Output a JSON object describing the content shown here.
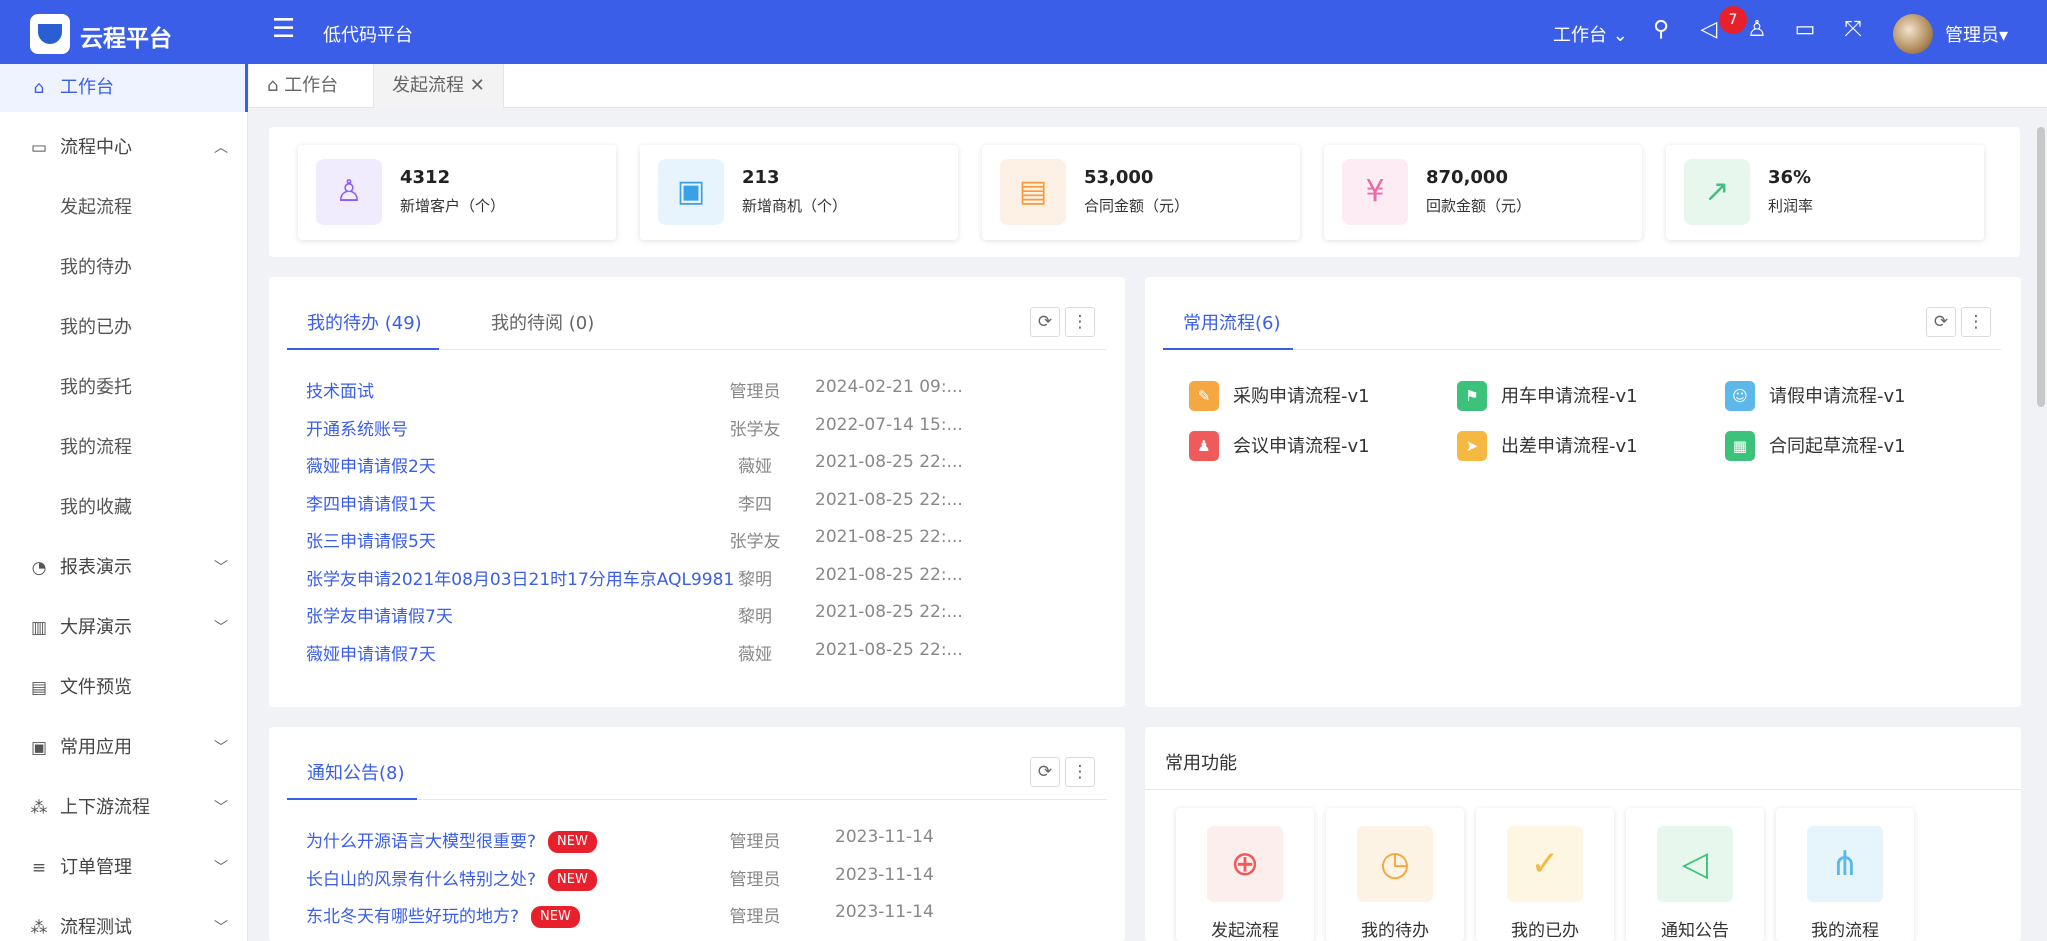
{
  "topbar": {
    "brand": "云程平台",
    "platform_title": "低代码平台",
    "workspace_label": "工作台",
    "notification_count": "7",
    "user_name": "管理员"
  },
  "sidebar": {
    "items": [
      {
        "label": "工作台",
        "icon": "home-icon"
      },
      {
        "label": "流程中心",
        "icon": "monitor-icon"
      },
      {
        "label": "发起流程"
      },
      {
        "label": "我的待办"
      },
      {
        "label": "我的已办"
      },
      {
        "label": "我的委托"
      },
      {
        "label": "我的流程"
      },
      {
        "label": "我的收藏"
      },
      {
        "label": "报表演示",
        "icon": "pie-chart-icon"
      },
      {
        "label": "大屏演示",
        "icon": "bar-chart-icon"
      },
      {
        "label": "文件预览",
        "icon": "file-search-icon"
      },
      {
        "label": "常用应用",
        "icon": "briefcase-icon"
      },
      {
        "label": "上下游流程",
        "icon": "flow-tree-icon"
      },
      {
        "label": "订单管理",
        "icon": "order-icon"
      },
      {
        "label": "流程测试",
        "icon": "flow-test-icon"
      }
    ]
  },
  "tabs": [
    {
      "label": "工作台"
    },
    {
      "label": "发起流程"
    }
  ],
  "stats": [
    {
      "value": "4312",
      "label": "新增客户（个）",
      "icon": "user-icon",
      "color": "#8b5cf6",
      "bg": "#f1ecfd"
    },
    {
      "value": "213",
      "label": "新增商机（个）",
      "icon": "archive-icon",
      "color": "#3aa0e8",
      "bg": "#e8f4fd"
    },
    {
      "value": "53,000",
      "label": "合同金额（元）",
      "icon": "document-icon",
      "color": "#f79a3a",
      "bg": "#fdf1e5"
    },
    {
      "value": "870,000",
      "label": "回款金额（元）",
      "icon": "money-bag-icon",
      "color": "#ea6aa5",
      "bg": "#fdecf3"
    },
    {
      "value": "36%",
      "label": "利润率",
      "icon": "trend-chart-icon",
      "color": "#3cc27a",
      "bg": "#e8f7ee"
    }
  ],
  "todo_panel": {
    "tab_active": "我的待办 (49)",
    "tab_other": "我的待阅 (0)",
    "rows": [
      {
        "title": "技术面试",
        "person": "管理员",
        "date": "2024-02-21 09:..."
      },
      {
        "title": "开通系统账号",
        "person": "张学友",
        "date": "2022-07-14 15:..."
      },
      {
        "title": "薇娅申请请假2天",
        "person": "薇娅",
        "date": "2021-08-25 22:..."
      },
      {
        "title": "李四申请请假1天",
        "person": "李四",
        "date": "2021-08-25 22:..."
      },
      {
        "title": "张三申请请假5天",
        "person": "张学友",
        "date": "2021-08-25 22:..."
      },
      {
        "title": "张学友申请2021年08月03日21时17分用车京AQL9981",
        "person": "黎明",
        "date": "2021-08-25 22:..."
      },
      {
        "title": "张学友申请请假7天",
        "person": "黎明",
        "date": "2021-08-25 22:..."
      },
      {
        "title": "薇娅申请请假7天",
        "person": "薇娅",
        "date": "2021-08-25 22:..."
      }
    ]
  },
  "process_panel": {
    "tab": "常用流程(6)",
    "items": [
      {
        "label": "采购申请流程-v1",
        "icon": "purchase-icon",
        "color": "#f5a742"
      },
      {
        "label": "用车申请流程-v1",
        "icon": "flag-icon",
        "color": "#3cc27a"
      },
      {
        "label": "请假申请流程-v1",
        "icon": "people-icon",
        "color": "#5cb8e8"
      },
      {
        "label": "会议申请流程-v1",
        "icon": "meeting-icon",
        "color": "#ef5a5a"
      },
      {
        "label": "出差申请流程-v1",
        "icon": "send-icon",
        "color": "#f5b942"
      },
      {
        "label": "合同起草流程-v1",
        "icon": "contract-icon",
        "color": "#3cc27a"
      }
    ]
  },
  "notice_panel": {
    "tab": "通知公告(8)",
    "new_label": "NEW",
    "rows": [
      {
        "title": "为什么开源语言大模型很重要?",
        "person": "管理员",
        "date": "2023-11-14"
      },
      {
        "title": "长白山的风景有什么特别之处?",
        "person": "管理员",
        "date": "2023-11-14"
      },
      {
        "title": "东北冬天有哪些好玩的地方?",
        "person": "管理员",
        "date": "2023-11-14"
      }
    ]
  },
  "function_panel": {
    "title": "常用功能",
    "items": [
      {
        "label": "发起流程",
        "icon": "plus-circle-icon",
        "color": "#ef5a5a",
        "bg": "#fdeeee"
      },
      {
        "label": "我的待办",
        "icon": "clock-icon",
        "color": "#f5a742",
        "bg": "#fdf3e5"
      },
      {
        "label": "我的已办",
        "icon": "user-check-icon",
        "color": "#f5b942",
        "bg": "#fdf6e3"
      },
      {
        "label": "通知公告",
        "icon": "speaker-icon",
        "color": "#3cc27a",
        "bg": "#e8f7ee"
      },
      {
        "label": "我的流程",
        "icon": "org-chart-icon",
        "color": "#5cb8e8",
        "bg": "#e6f4fb"
      }
    ]
  }
}
